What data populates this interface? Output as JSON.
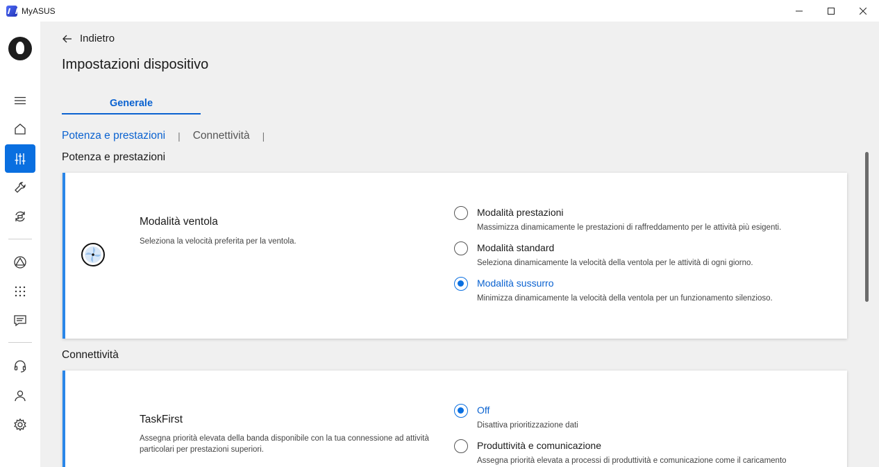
{
  "window": {
    "title": "MyASUS",
    "minimize_glyph": "—",
    "maximize_glyph": "☐",
    "close_glyph": "✕"
  },
  "sidebar": {
    "items": [
      {
        "name": "menu",
        "icon": "hamburger-menu-icon"
      },
      {
        "name": "home",
        "icon": "home-icon"
      },
      {
        "name": "customization",
        "icon": "sliders-icon",
        "active": true
      },
      {
        "name": "system-diagnosis",
        "icon": "wrench-icon"
      },
      {
        "name": "recovery",
        "icon": "refresh-icon"
      },
      {
        "name": "link-to-myasus",
        "icon": "triangle-circle-icon"
      },
      {
        "name": "app-deals",
        "icon": "grid-dots-icon"
      },
      {
        "name": "news",
        "icon": "message-icon"
      },
      {
        "name": "support",
        "icon": "headset-icon"
      },
      {
        "name": "user",
        "icon": "user-icon"
      },
      {
        "name": "settings",
        "icon": "gear-icon"
      }
    ],
    "accent": "#0a6fe0"
  },
  "header": {
    "back_label": "Indietro",
    "page_title": "Impostazioni dispositivo"
  },
  "tabs": [
    {
      "label": "Generale",
      "active": true
    }
  ],
  "anchors": [
    {
      "label": "Potenza e prestazioni",
      "active": true
    },
    {
      "label": "Connettività",
      "active": false
    }
  ],
  "anchor_separator": "|",
  "sections": [
    {
      "title": "Potenza e prestazioni",
      "card": {
        "icon": "fan-icon",
        "name": "Modalità ventola",
        "description": "Seleziona la velocità preferita per la ventola.",
        "options": [
          {
            "label": "Modalità prestazioni",
            "description": "Massimizza dinamicamente le prestazioni di raffreddamento per le attività più esigenti.",
            "selected": false
          },
          {
            "label": "Modalità standard",
            "description": "Seleziona dinamicamente la velocità della ventola per le attività di ogni giorno.",
            "selected": false
          },
          {
            "label": "Modalità sussurro",
            "description": "Minimizza dinamicamente la velocità della ventola per un funzionamento silenzioso.",
            "selected": true
          }
        ]
      }
    },
    {
      "title": "Connettività",
      "card": {
        "name": "TaskFirst",
        "description": "Assegna priorità elevata della banda disponibile con la tua connessione ad attività particolari per prestazioni superiori.",
        "options": [
          {
            "label": "Off",
            "description": "Disattiva prioritizzazione dati",
            "selected": true
          },
          {
            "label": "Produttività e comunicazione",
            "description": "Assegna priorità elevata a processi di produttività e comunicazione come il caricamento",
            "selected": false
          }
        ]
      }
    }
  ],
  "colors": {
    "accent": "#0a62d0",
    "card_border": "#2a86e8",
    "background": "#f0f0f0"
  }
}
